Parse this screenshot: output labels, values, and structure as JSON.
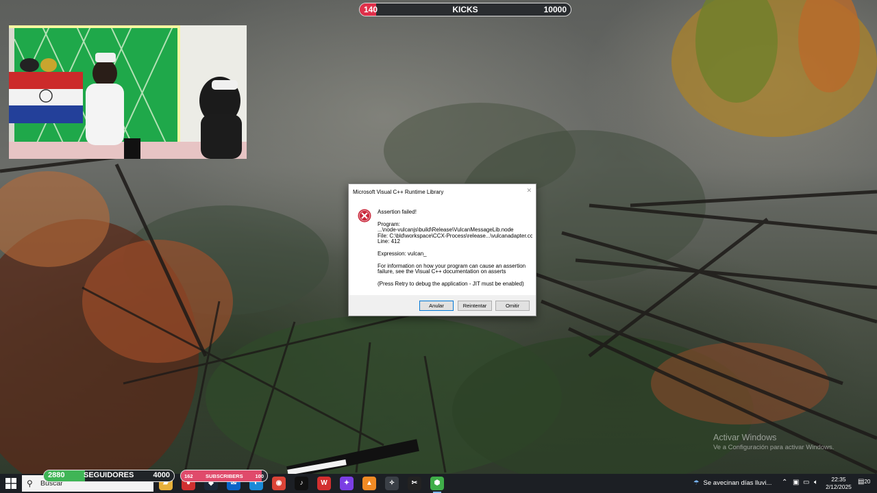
{
  "kicks": {
    "current": "140",
    "label": "KICKS",
    "max": "10000",
    "progress": 0.014,
    "color": "#e0304a"
  },
  "dialog": {
    "title": "Microsoft Visual C++ Runtime Library",
    "close": "✕",
    "icon": "error-icon",
    "heading": "Assertion failed!",
    "program_label": "Program:",
    "program_path": "...\\node-vulcanjs\\build\\Release\\VulcanMessageLib.node",
    "file_line": "File: C:\\bld\\workspace\\CCX-Process\\release...\\vulcanadapter.cc",
    "line": "Line: 412",
    "expression": "Expression: vulcan_",
    "info_1": "For information on how your program can cause an assertion",
    "info_2": "failure, see the Visual C++ documentation on asserts",
    "retry_note": "(Press Retry to debug the application - JIT must be enabled)",
    "buttons": {
      "abort": "Anular",
      "retry": "Reintentar",
      "ignore": "Omitir"
    }
  },
  "watermark": {
    "line1": "Activar Windows",
    "line2": "Ve a Configuración para activar Windows."
  },
  "followers": {
    "current": "2880",
    "label": "SEGUIDORES",
    "max": "4000",
    "color": "#3fb556"
  },
  "subscribers": {
    "current": "162",
    "label": "SUBSCRIBERS",
    "max": "100",
    "color": "#e04a6b"
  },
  "taskbar": {
    "search_placeholder": "Buscar",
    "apps": [
      {
        "name": "file-explorer-icon",
        "color": "#e8b03a"
      },
      {
        "name": "red-app-icon",
        "color": "#d03030"
      },
      {
        "name": "steam-icon",
        "color": "#1b2838"
      },
      {
        "name": "outlook-icon",
        "color": "#0a64c8"
      },
      {
        "name": "edge-icon",
        "color": "#1a8ad8"
      },
      {
        "name": "chrome-icon",
        "color": "#db4437"
      },
      {
        "name": "tiktok-icon",
        "color": "#111111"
      },
      {
        "name": "wps-icon",
        "color": "#d32f2f"
      },
      {
        "name": "messenger-icon",
        "color": "#7b3fe4"
      },
      {
        "name": "vlc-icon",
        "color": "#f08a24"
      },
      {
        "name": "settings-icon",
        "color": "#3a3f46"
      },
      {
        "name": "capcut-icon",
        "color": "#222222"
      },
      {
        "name": "green-cube-icon",
        "color": "#3fae49"
      }
    ],
    "weather": "Se avecinan días lluvi...",
    "time": "22:35",
    "date": "2/12/2025",
    "notifications": "20"
  }
}
